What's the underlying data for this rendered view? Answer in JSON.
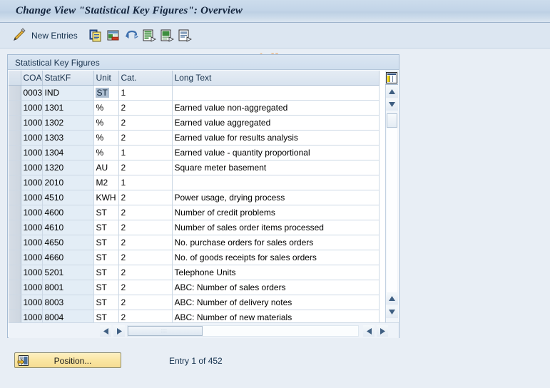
{
  "window": {
    "title": "Change View \"Statistical Key Figures\": Overview"
  },
  "toolbar": {
    "edit_icon": "pencil-icon",
    "new_entries_label": "New Entries",
    "icons": [
      {
        "name": "copy-as-icon"
      },
      {
        "name": "delete-row-icon"
      },
      {
        "name": "undo-icon"
      },
      {
        "name": "select-layout-icon"
      },
      {
        "name": "variant-icon"
      },
      {
        "name": "print-preview-icon"
      }
    ]
  },
  "watermark": "www.tutorialkart.com",
  "panel": {
    "title": "Statistical Key Figures"
  },
  "table": {
    "columns": [
      "COAr",
      "StatKF",
      "Unit",
      "Cat.",
      "Long Text"
    ],
    "config_icon": "column-config-icon",
    "active_cell": {
      "row": 0,
      "column": "Unit",
      "value": "ST"
    },
    "rows": [
      {
        "coar": "0003",
        "statkf": "IND",
        "unit": "ST",
        "cat": "1",
        "long_text": ""
      },
      {
        "coar": "1000",
        "statkf": "1301",
        "unit": "%",
        "cat": "2",
        "long_text": "Earned value non-aggregated"
      },
      {
        "coar": "1000",
        "statkf": "1302",
        "unit": "%",
        "cat": "2",
        "long_text": "Earned value aggregated"
      },
      {
        "coar": "1000",
        "statkf": "1303",
        "unit": "%",
        "cat": "2",
        "long_text": "Earned value for results analysis"
      },
      {
        "coar": "1000",
        "statkf": "1304",
        "unit": "%",
        "cat": "1",
        "long_text": "Earned value - quantity proportional"
      },
      {
        "coar": "1000",
        "statkf": "1320",
        "unit": "AU",
        "cat": "2",
        "long_text": "Square meter basement"
      },
      {
        "coar": "1000",
        "statkf": "2010",
        "unit": "M2",
        "cat": "1",
        "long_text": ""
      },
      {
        "coar": "1000",
        "statkf": "4510",
        "unit": "KWH",
        "cat": "2",
        "long_text": "Power usage, drying process"
      },
      {
        "coar": "1000",
        "statkf": "4600",
        "unit": "ST",
        "cat": "2",
        "long_text": "Number of credit problems"
      },
      {
        "coar": "1000",
        "statkf": "4610",
        "unit": "ST",
        "cat": "2",
        "long_text": "Number of sales order items processed"
      },
      {
        "coar": "1000",
        "statkf": "4650",
        "unit": "ST",
        "cat": "2",
        "long_text": "No. purchase orders for sales orders"
      },
      {
        "coar": "1000",
        "statkf": "4660",
        "unit": "ST",
        "cat": "2",
        "long_text": "No. of goods receipts for sales orders"
      },
      {
        "coar": "1000",
        "statkf": "5201",
        "unit": "ST",
        "cat": "2",
        "long_text": "Telephone Units"
      },
      {
        "coar": "1000",
        "statkf": "8001",
        "unit": "ST",
        "cat": "2",
        "long_text": "ABC: Number of sales orders"
      },
      {
        "coar": "1000",
        "statkf": "8003",
        "unit": "ST",
        "cat": "2",
        "long_text": "ABC: Number of delivery notes"
      },
      {
        "coar": "1000",
        "statkf": "8004",
        "unit": "ST",
        "cat": "2",
        "long_text": "ABC: Number of new materials"
      }
    ]
  },
  "footer": {
    "position_button_label": "Position...",
    "position_button_icon": "position-icon",
    "entry_status": "Entry 1 of 452"
  },
  "colors": {
    "window_bg": "#e8eef5",
    "titlebar": "#c3d5e8",
    "toolbar": "#dce6f1",
    "key_cell": "#e3edf6",
    "active_cell": "#aebfd2",
    "watermark": "#eab98a",
    "button_gold": "#fae6a3"
  }
}
